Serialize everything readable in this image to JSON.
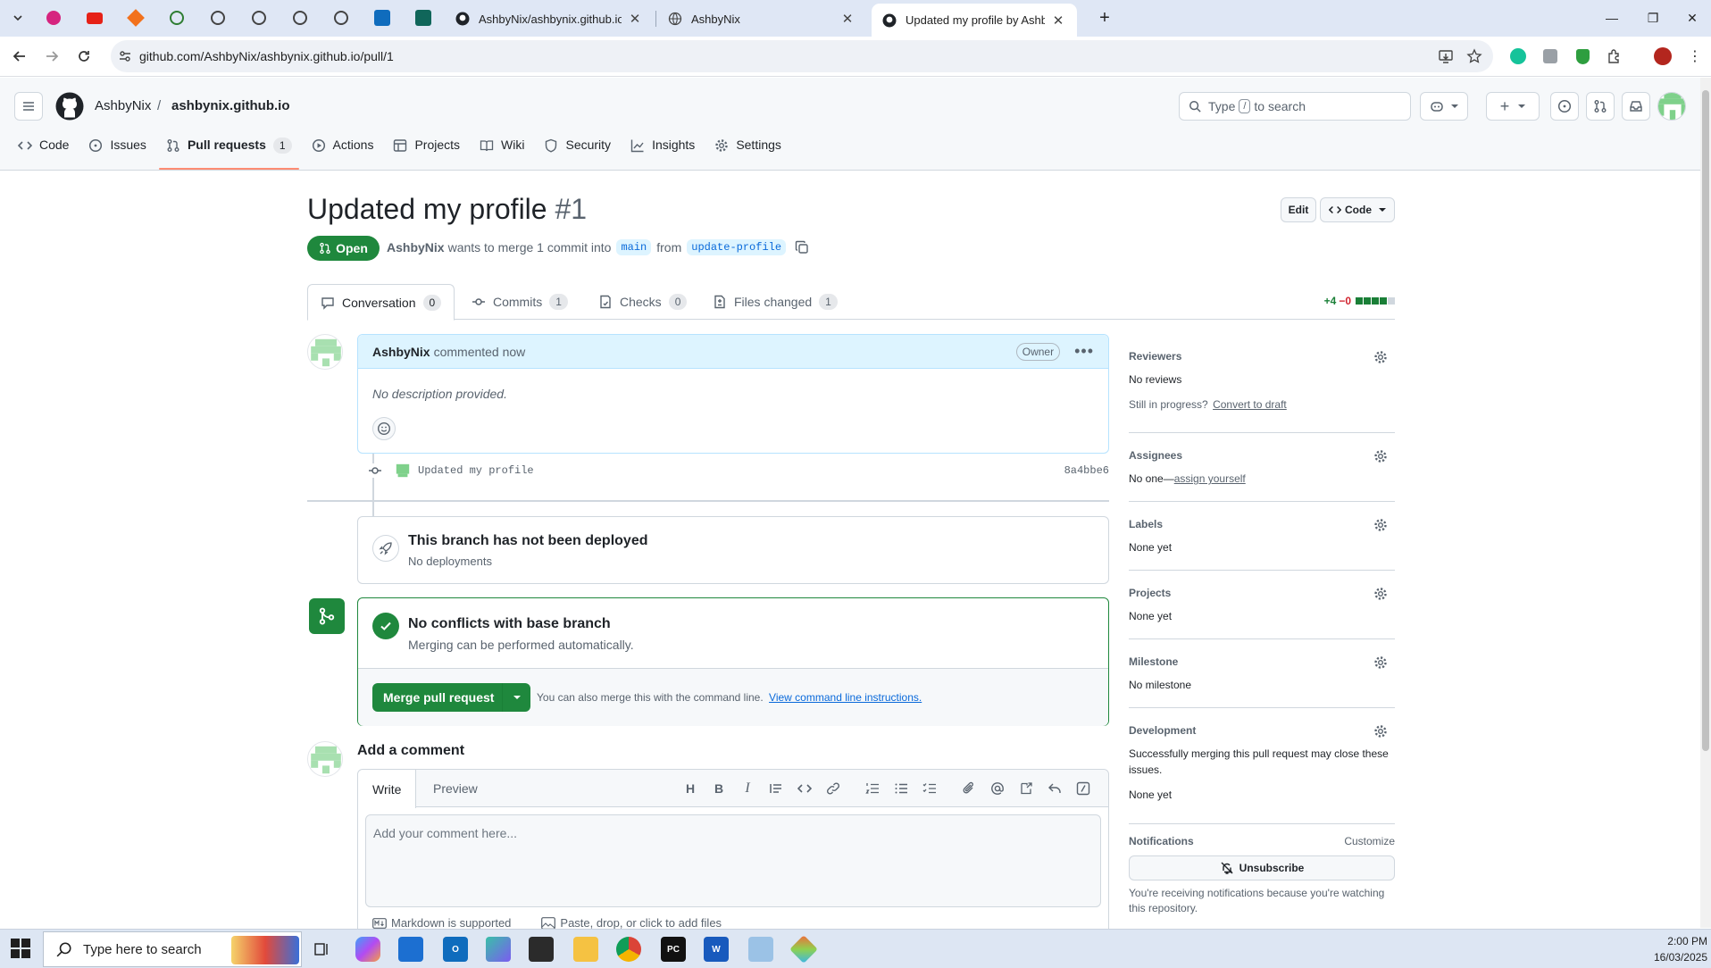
{
  "browser": {
    "tabs": [
      {
        "label": "AshbyNix/ashbynix.github.io"
      },
      {
        "label": "AshbyNix"
      },
      {
        "label": "Updated my profile by AshbyNix"
      }
    ],
    "url": "github.com/AshbyNix/ashbynix.github.io/pull/1"
  },
  "header": {
    "owner": "AshbyNix",
    "separator": "/",
    "repo": "ashbynix.github.io",
    "search_prefix": "Type",
    "search_key": "/",
    "search_suffix": "to search"
  },
  "repo_nav": [
    {
      "label": "Code",
      "icon": "code-icon"
    },
    {
      "label": "Issues",
      "icon": "issue-icon"
    },
    {
      "label": "Pull requests",
      "icon": "pull-request-icon",
      "count": "1"
    },
    {
      "label": "Actions",
      "icon": "play-icon"
    },
    {
      "label": "Projects",
      "icon": "table-icon"
    },
    {
      "label": "Wiki",
      "icon": "book-icon"
    },
    {
      "label": "Security",
      "icon": "shield-icon"
    },
    {
      "label": "Insights",
      "icon": "graph-icon"
    },
    {
      "label": "Settings",
      "icon": "gear-icon"
    }
  ],
  "pr": {
    "title": "Updated my profile",
    "number": "#1",
    "edit_label": "Edit",
    "code_label": "Code",
    "state": "Open",
    "author": "AshbyNix",
    "merge_text": "wants to merge 1 commit into",
    "base": "main",
    "from_text": "from",
    "head": "update-profile"
  },
  "pr_tabs": [
    {
      "label": "Conversation",
      "count": "0"
    },
    {
      "label": "Commits",
      "count": "1"
    },
    {
      "label": "Checks",
      "count": "0"
    },
    {
      "label": "Files changed",
      "count": "1"
    }
  ],
  "diffstat": {
    "additions": "+4",
    "deletions": "−0",
    "add_color": "#1a7f37",
    "del_color": "#d1242f"
  },
  "comment": {
    "author": "AshbyNix",
    "time": "commented now",
    "badge": "Owner",
    "body": "No description provided."
  },
  "commit": {
    "message": "Updated my profile",
    "sha": "8a4bbe6"
  },
  "deploy": {
    "title": "This branch has not been deployed",
    "subtitle": "No deployments"
  },
  "merge": {
    "title": "No conflicts with base branch",
    "subtitle": "Merging can be performed automatically.",
    "button": "Merge pull request",
    "hint": "You can also merge this with the command line.",
    "hint_link": "View command line instructions."
  },
  "add_comment": {
    "title": "Add a comment",
    "tab_write": "Write",
    "tab_preview": "Preview",
    "placeholder": "Add your comment here...",
    "markdown": "Markdown is supported",
    "attach": "Paste, drop, or click to add files"
  },
  "sidebar": {
    "reviewers": {
      "title": "Reviewers",
      "value": "No reviews",
      "progress": "Still in progress?",
      "progress_link": "Convert to draft"
    },
    "assignees": {
      "title": "Assignees",
      "value": "No one—",
      "link": "assign yourself"
    },
    "labels": {
      "title": "Labels",
      "value": "None yet"
    },
    "projects": {
      "title": "Projects",
      "value": "None yet"
    },
    "milestone": {
      "title": "Milestone",
      "value": "No milestone"
    },
    "development": {
      "title": "Development",
      "text": "Successfully merging this pull request may close these issues.",
      "value": "None yet"
    },
    "notifications": {
      "title": "Notifications",
      "customize": "Customize",
      "button": "Unsubscribe",
      "text": "You're receiving notifications because you're watching this repository."
    }
  },
  "taskbar": {
    "search": "Type here to search",
    "time": "2:00 PM",
    "date": "16/03/2025"
  },
  "colors": {
    "accent_green": "#1f883d",
    "link_blue": "#0969da",
    "tab_underline": "#fd8c73"
  }
}
